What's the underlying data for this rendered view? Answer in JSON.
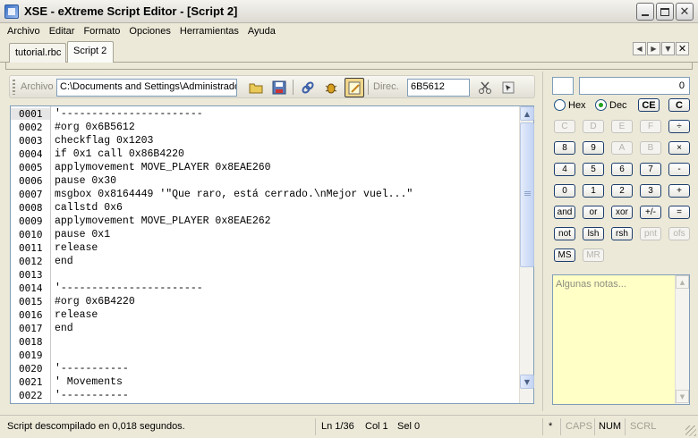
{
  "window": {
    "title": "XSE - eXtreme Script Editor - [Script 2]"
  },
  "menu": [
    "Archivo",
    "Editar",
    "Formato",
    "Opciones",
    "Herramientas",
    "Ayuda"
  ],
  "tabs": [
    {
      "label": "tutorial.rbc",
      "active": false
    },
    {
      "label": "Script 2",
      "active": true
    }
  ],
  "toolbar": {
    "file_label": "Archivo",
    "file_value": "C:\\Documents and Settings\\Administrador",
    "dir_label": "Direc.",
    "dir_value": "6B5612"
  },
  "editor": {
    "current_line": "0001",
    "lines": [
      {
        "num": "0001",
        "text": "'-----------------------"
      },
      {
        "num": "0002",
        "text": "#org 0x6B5612"
      },
      {
        "num": "0003",
        "text": "checkflag 0x1203"
      },
      {
        "num": "0004",
        "text": "if 0x1 call 0x86B4220"
      },
      {
        "num": "0005",
        "text": "applymovement MOVE_PLAYER 0x8EAE260"
      },
      {
        "num": "0006",
        "text": "pause 0x30"
      },
      {
        "num": "0007",
        "text": "msgbox 0x8164449 '\"Que raro, está cerrado.\\nMejor vuel...\""
      },
      {
        "num": "0008",
        "text": "callstd 0x6"
      },
      {
        "num": "0009",
        "text": "applymovement MOVE_PLAYER 0x8EAE262"
      },
      {
        "num": "0010",
        "text": "pause 0x1"
      },
      {
        "num": "0011",
        "text": "release"
      },
      {
        "num": "0012",
        "text": "end"
      },
      {
        "num": "0013",
        "text": ""
      },
      {
        "num": "0014",
        "text": "'-----------------------"
      },
      {
        "num": "0015",
        "text": "#org 0x6B4220"
      },
      {
        "num": "0016",
        "text": "release"
      },
      {
        "num": "0017",
        "text": "end"
      },
      {
        "num": "0018",
        "text": ""
      },
      {
        "num": "0019",
        "text": ""
      },
      {
        "num": "0020",
        "text": "'-----------"
      },
      {
        "num": "0021",
        "text": "' Movements"
      },
      {
        "num": "0022",
        "text": "'-----------"
      }
    ]
  },
  "calculator": {
    "display": "0",
    "radios": [
      {
        "label": "Hex",
        "selected": false
      },
      {
        "label": "Dec",
        "selected": true
      }
    ],
    "clear_entry": "CE",
    "clear": "C",
    "rows": [
      [
        {
          "label": "C",
          "enabled": false
        },
        {
          "label": "D",
          "enabled": false
        },
        {
          "label": "E",
          "enabled": false
        },
        {
          "label": "F",
          "enabled": false
        },
        {
          "label": "÷",
          "enabled": true
        }
      ],
      [
        {
          "label": "8",
          "enabled": true
        },
        {
          "label": "9",
          "enabled": true
        },
        {
          "label": "A",
          "enabled": false
        },
        {
          "label": "B",
          "enabled": false
        },
        {
          "label": "×",
          "enabled": true
        }
      ],
      [
        {
          "label": "4",
          "enabled": true
        },
        {
          "label": "5",
          "enabled": true
        },
        {
          "label": "6",
          "enabled": true
        },
        {
          "label": "7",
          "enabled": true
        },
        {
          "label": "-",
          "enabled": true
        }
      ],
      [
        {
          "label": "0",
          "enabled": true
        },
        {
          "label": "1",
          "enabled": true
        },
        {
          "label": "2",
          "enabled": true
        },
        {
          "label": "3",
          "enabled": true
        },
        {
          "label": "+",
          "enabled": true
        }
      ],
      [
        {
          "label": "and",
          "enabled": true
        },
        {
          "label": "or",
          "enabled": true
        },
        {
          "label": "xor",
          "enabled": true
        },
        {
          "label": "+/-",
          "enabled": true
        },
        {
          "label": "=",
          "enabled": true
        }
      ],
      [
        {
          "label": "not",
          "enabled": true
        },
        {
          "label": "lsh",
          "enabled": true
        },
        {
          "label": "rsh",
          "enabled": true
        },
        {
          "label": "pnt",
          "enabled": false
        },
        {
          "label": "ofs",
          "enabled": false
        }
      ],
      [
        {
          "label": "MS",
          "enabled": true
        },
        {
          "label": "MR",
          "enabled": false
        }
      ]
    ],
    "notes_placeholder": "Algunas notas..."
  },
  "status": {
    "message": "Script descompilado en 0,018 segundos.",
    "line": "Ln 1/36",
    "col": "Col 1",
    "sel": "Sel 0",
    "modified": "*",
    "caps": "CAPS",
    "num": "NUM",
    "scrl": "SCRL"
  }
}
